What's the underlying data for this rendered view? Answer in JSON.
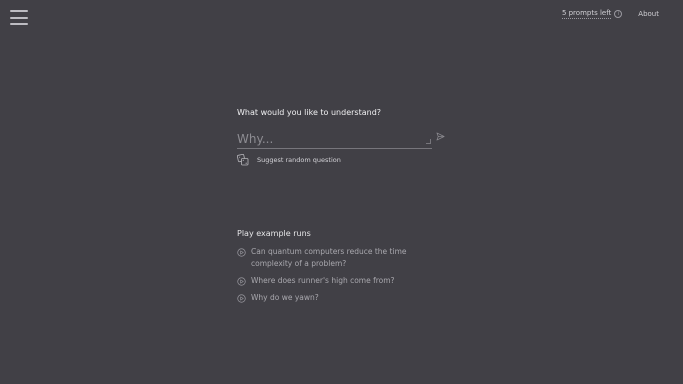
{
  "topbar": {
    "prompts_left": "5 prompts left",
    "about": "About"
  },
  "main": {
    "prompt_title": "What would you like to understand?",
    "input_value": "",
    "input_placeholder": "Why...",
    "suggest_label": "Suggest random question"
  },
  "examples": {
    "title": "Play example runs",
    "items": [
      {
        "label": "Can quantum computers reduce the time complexity of a problem?"
      },
      {
        "label": "Where does runner's high come from?"
      },
      {
        "label": "Why do we yawn?"
      }
    ]
  },
  "icons": {
    "menu": "hamburger-menu-icon",
    "info": "info-icon",
    "send": "send-icon",
    "dice": "dice-icon",
    "play": "play-circle-icon"
  },
  "colors": {
    "background": "#414046",
    "text": "#e8e8ea",
    "muted_text": "#a9a8ae"
  }
}
